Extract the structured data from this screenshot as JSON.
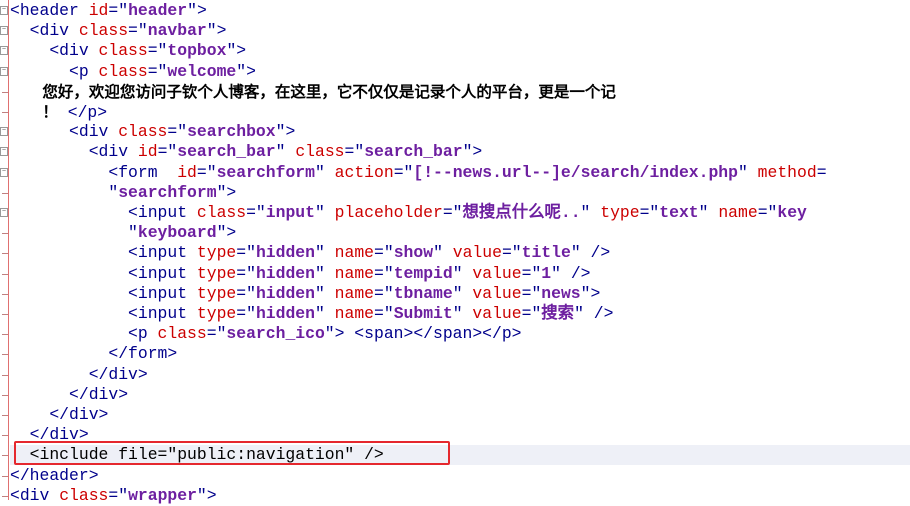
{
  "editor": {
    "lines": [
      {
        "seg": [
          [
            "t",
            "<header "
          ],
          [
            "a",
            "id"
          ],
          [
            "t",
            "=\""
          ],
          [
            "s",
            "header"
          ],
          [
            "t",
            "\">"
          ]
        ]
      },
      {
        "seg": [
          [
            "t",
            "  <div "
          ],
          [
            "a",
            "class"
          ],
          [
            "t",
            "=\""
          ],
          [
            "s",
            "navbar"
          ],
          [
            "t",
            "\">"
          ]
        ]
      },
      {
        "seg": [
          [
            "t",
            "    <div "
          ],
          [
            "a",
            "class"
          ],
          [
            "t",
            "=\""
          ],
          [
            "s",
            "topbox"
          ],
          [
            "t",
            "\">"
          ]
        ]
      },
      {
        "seg": [
          [
            "t",
            "      <p "
          ],
          [
            "a",
            "class"
          ],
          [
            "t",
            "=\""
          ],
          [
            "s",
            "welcome"
          ],
          [
            "t",
            "\">"
          ]
        ]
      },
      {
        "seg": [
          [
            "k",
            "      您好，欢迎您访问子钦个人博客，在这里，它不仅仅是记录个人的平台，更是一个记"
          ]
        ]
      },
      {
        "seg": [
          [
            "k",
            "      ！"
          ],
          [
            "t",
            " </p>"
          ]
        ]
      },
      {
        "seg": [
          [
            "t",
            "      <div "
          ],
          [
            "a",
            "class"
          ],
          [
            "t",
            "=\""
          ],
          [
            "s",
            "searchbox"
          ],
          [
            "t",
            "\">"
          ]
        ]
      },
      {
        "seg": [
          [
            "t",
            "        <div "
          ],
          [
            "a",
            "id"
          ],
          [
            "t",
            "=\""
          ],
          [
            "s",
            "search_bar"
          ],
          [
            "t",
            "\" "
          ],
          [
            "a",
            "class"
          ],
          [
            "t",
            "=\""
          ],
          [
            "s",
            "search_bar"
          ],
          [
            "t",
            "\">"
          ]
        ]
      },
      {
        "seg": [
          [
            "t",
            "          <form  "
          ],
          [
            "a",
            "id"
          ],
          [
            "t",
            "=\""
          ],
          [
            "s",
            "searchform"
          ],
          [
            "t",
            "\" "
          ],
          [
            "a",
            "action"
          ],
          [
            "t",
            "=\""
          ],
          [
            "s",
            "[!--news.url--]e/search/index.php"
          ],
          [
            "t",
            "\" "
          ],
          [
            "a",
            "method"
          ],
          [
            "t",
            "="
          ]
        ]
      },
      {
        "seg": [
          [
            "t",
            "          \""
          ],
          [
            "s",
            "searchform"
          ],
          [
            "t",
            "\">"
          ]
        ]
      },
      {
        "seg": [
          [
            "t",
            "            <input "
          ],
          [
            "a",
            "class"
          ],
          [
            "t",
            "=\""
          ],
          [
            "s",
            "input"
          ],
          [
            "t",
            "\" "
          ],
          [
            "a",
            "placeholder"
          ],
          [
            "t",
            "=\""
          ],
          [
            "s",
            "想搜点什么呢.."
          ],
          [
            "t",
            "\" "
          ],
          [
            "a",
            "type"
          ],
          [
            "t",
            "=\""
          ],
          [
            "s",
            "text"
          ],
          [
            "t",
            "\" "
          ],
          [
            "a",
            "name"
          ],
          [
            "t",
            "=\""
          ],
          [
            "s",
            "key"
          ]
        ]
      },
      {
        "seg": [
          [
            "t",
            "            \""
          ],
          [
            "s",
            "keyboard"
          ],
          [
            "t",
            "\">"
          ]
        ]
      },
      {
        "seg": [
          [
            "t",
            "            <input "
          ],
          [
            "a",
            "type"
          ],
          [
            "t",
            "=\""
          ],
          [
            "s",
            "hidden"
          ],
          [
            "t",
            "\" "
          ],
          [
            "a",
            "name"
          ],
          [
            "t",
            "=\""
          ],
          [
            "s",
            "show"
          ],
          [
            "t",
            "\" "
          ],
          [
            "a",
            "value"
          ],
          [
            "t",
            "=\""
          ],
          [
            "s",
            "title"
          ],
          [
            "t",
            "\" />"
          ]
        ]
      },
      {
        "seg": [
          [
            "t",
            "            <input "
          ],
          [
            "a",
            "type"
          ],
          [
            "t",
            "=\""
          ],
          [
            "s",
            "hidden"
          ],
          [
            "t",
            "\" "
          ],
          [
            "a",
            "name"
          ],
          [
            "t",
            "=\""
          ],
          [
            "s",
            "tempid"
          ],
          [
            "t",
            "\" "
          ],
          [
            "a",
            "value"
          ],
          [
            "t",
            "=\""
          ],
          [
            "s",
            "1"
          ],
          [
            "t",
            "\" />"
          ]
        ]
      },
      {
        "seg": [
          [
            "t",
            "            <input "
          ],
          [
            "a",
            "type"
          ],
          [
            "t",
            "=\""
          ],
          [
            "s",
            "hidden"
          ],
          [
            "t",
            "\" "
          ],
          [
            "a",
            "name"
          ],
          [
            "t",
            "=\""
          ],
          [
            "s",
            "tbname"
          ],
          [
            "t",
            "\" "
          ],
          [
            "a",
            "value"
          ],
          [
            "t",
            "=\""
          ],
          [
            "s",
            "news"
          ],
          [
            "t",
            "\">"
          ]
        ]
      },
      {
        "seg": [
          [
            "t",
            "            <input "
          ],
          [
            "a",
            "type"
          ],
          [
            "t",
            "=\""
          ],
          [
            "s",
            "hidden"
          ],
          [
            "t",
            "\" "
          ],
          [
            "a",
            "name"
          ],
          [
            "t",
            "=\""
          ],
          [
            "s",
            "Submit"
          ],
          [
            "t",
            "\" "
          ],
          [
            "a",
            "value"
          ],
          [
            "t",
            "=\""
          ],
          [
            "s",
            "搜索"
          ],
          [
            "t",
            "\" />"
          ]
        ]
      },
      {
        "seg": [
          [
            "t",
            "            <p "
          ],
          [
            "a",
            "class"
          ],
          [
            "t",
            "=\""
          ],
          [
            "s",
            "search_ico"
          ],
          [
            "t",
            "\"> <span></span></p>"
          ]
        ]
      },
      {
        "seg": [
          [
            "t",
            "          </form>"
          ]
        ]
      },
      {
        "seg": [
          [
            "t",
            "        </div>"
          ]
        ]
      },
      {
        "seg": [
          [
            "t",
            "      </div>"
          ]
        ]
      },
      {
        "seg": [
          [
            "t",
            "    </div>"
          ]
        ]
      },
      {
        "seg": [
          [
            "t",
            "  </div>"
          ]
        ]
      },
      {
        "seg": [
          [
            "txt",
            "  <include file=\"public:navigation\" />"
          ]
        ],
        "highlight": true
      },
      {
        "seg": [
          [
            "t",
            "</header>"
          ]
        ]
      },
      {
        "seg": [
          [
            "t",
            "<div "
          ],
          [
            "a",
            "class"
          ],
          [
            "t",
            "=\""
          ],
          [
            "s",
            "wrapper"
          ],
          [
            "t",
            "\">"
          ]
        ]
      }
    ]
  }
}
